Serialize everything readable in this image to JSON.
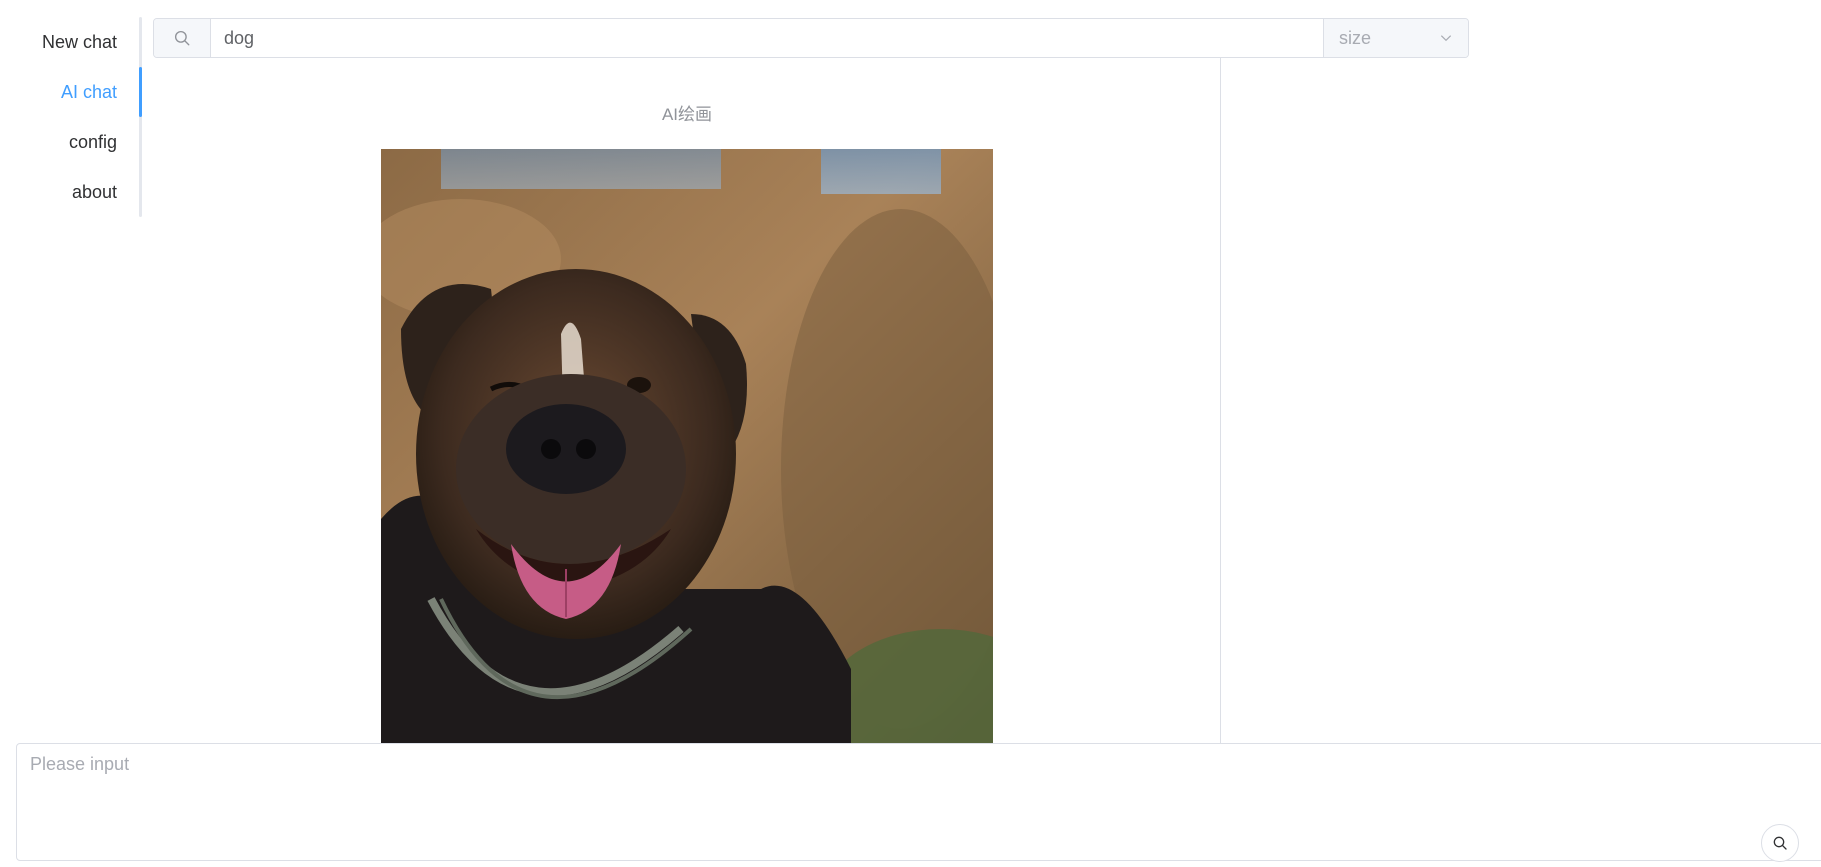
{
  "sidebar": {
    "items": [
      {
        "label": "New chat"
      },
      {
        "label": "AI chat"
      },
      {
        "label": "config"
      },
      {
        "label": "about"
      }
    ],
    "active_index": 1
  },
  "search": {
    "value": "dog",
    "icon": "search-icon",
    "size_select": {
      "placeholder": "size",
      "icon": "chevron-down-icon"
    }
  },
  "main": {
    "title": "AI绘画",
    "image": {
      "subject": "dog"
    }
  },
  "chat_input": {
    "placeholder": "Please input",
    "send_icon": "search-icon"
  },
  "colors": {
    "accent": "#409eff",
    "border": "#dcdfe6",
    "placeholder": "#a8abb2"
  }
}
